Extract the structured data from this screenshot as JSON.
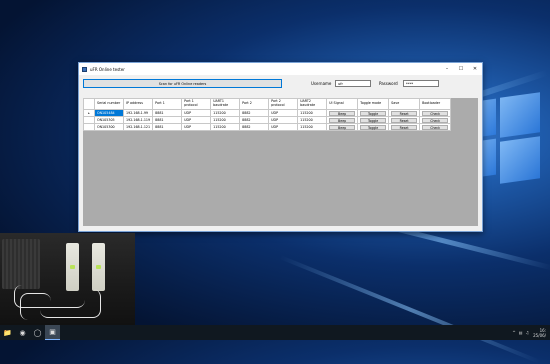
{
  "window": {
    "title": "uFR Online tester",
    "controls": [
      "–",
      "☐",
      "✕"
    ]
  },
  "toolbar": {
    "scan_label": "Scan for uFR Online readers",
    "username_label": "Username",
    "username_value": "ufr",
    "password_label": "Password",
    "password_value": "****"
  },
  "grid": {
    "headers": [
      "Serial number",
      "IP address",
      "Port 1",
      "Port 1 protocol",
      "UART1 baudrate",
      "Port 2",
      "Port 2 protocol",
      "UART2 baudrate",
      "UI Signal",
      "Toggle mode",
      "Save",
      "Bootloader"
    ],
    "rows": [
      {
        "marker": "▸",
        "serial": "ON105484",
        "ip": "192.168.1.99",
        "port1": "8881",
        "proto1": "UDP",
        "baud1": "115200",
        "port2": "8882",
        "proto2": "UDP",
        "baud2": "115200",
        "ui": "Beep",
        "toggle": "Toggle",
        "save": "Reset",
        "boot": "Check"
      },
      {
        "marker": "",
        "serial": "ON105305",
        "ip": "192.168.1.119",
        "port1": "8881",
        "proto1": "UDP",
        "baud1": "115200",
        "port2": "8882",
        "proto2": "UDP",
        "baud2": "115200",
        "ui": "Beep",
        "toggle": "Toggle",
        "save": "Reset",
        "boot": "Check"
      },
      {
        "marker": "",
        "serial": "ON105300",
        "ip": "192.168.1.121",
        "port1": "8881",
        "proto1": "UDP",
        "baud1": "115200",
        "port2": "8882",
        "proto2": "UDP",
        "baud2": "115200",
        "ui": "Beep",
        "toggle": "Toggle",
        "save": "Reset",
        "boot": "Check"
      }
    ]
  },
  "taskbar": {
    "icons": [
      "folder-icon",
      "chrome-icon",
      "obs-icon",
      "app-icon"
    ],
    "clock_time": "16:",
    "clock_date": "25/06/"
  },
  "colors": {
    "selection": "#0078d7",
    "focus_border": "#0078d7",
    "grid_background": "#ababab"
  }
}
